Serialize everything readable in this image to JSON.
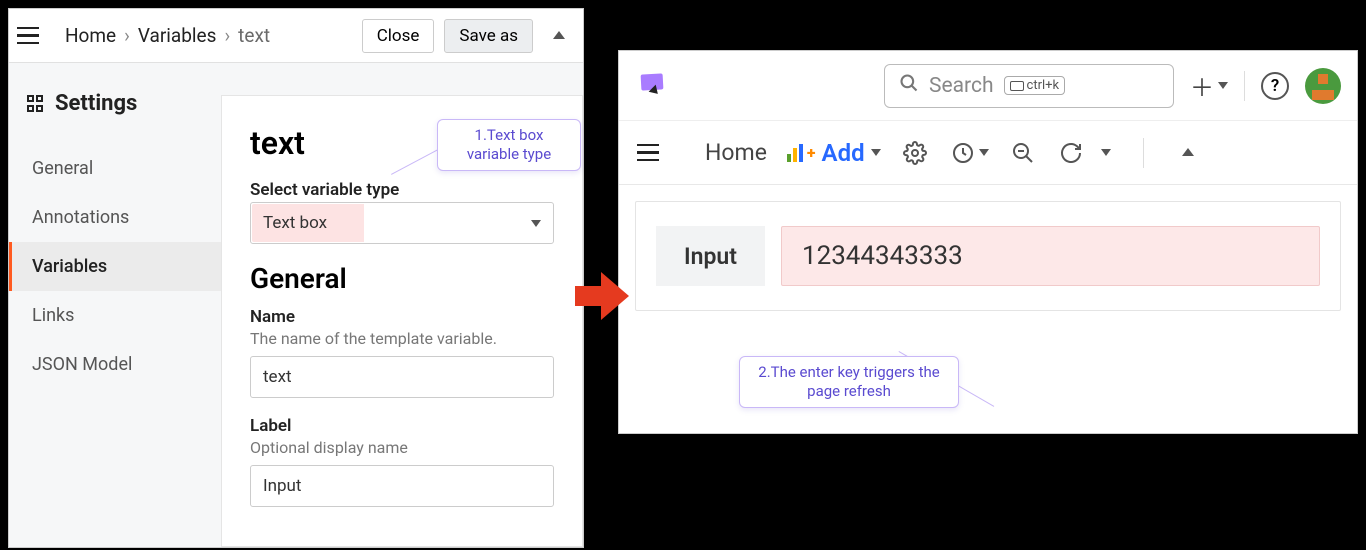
{
  "left": {
    "breadcrumb": {
      "home": "Home",
      "variables": "Variables",
      "current": "text"
    },
    "buttons": {
      "close": "Close",
      "saveas": "Save as"
    },
    "sidebar": {
      "title": "Settings",
      "items": [
        "General",
        "Annotations",
        "Variables",
        "Links",
        "JSON Model"
      ],
      "activeIndex": 2
    },
    "content": {
      "title": "text",
      "selectLabel": "Select variable type",
      "selectValue": "Text box",
      "generalHeading": "General",
      "name": {
        "label": "Name",
        "help": "The name of the template variable.",
        "value": "text"
      },
      "label": {
        "label": "Label",
        "help": "Optional display name",
        "value": "Input"
      }
    },
    "callout1": "1.Text box variable type"
  },
  "right": {
    "search": {
      "placeholder": "Search",
      "shortcut": "ctrl+k"
    },
    "toolbar": {
      "home": "Home",
      "add": "Add"
    },
    "panel": {
      "varLabel": "Input",
      "varValue": "12344343333"
    },
    "callout2": "2.The enter key triggers the page refresh"
  }
}
